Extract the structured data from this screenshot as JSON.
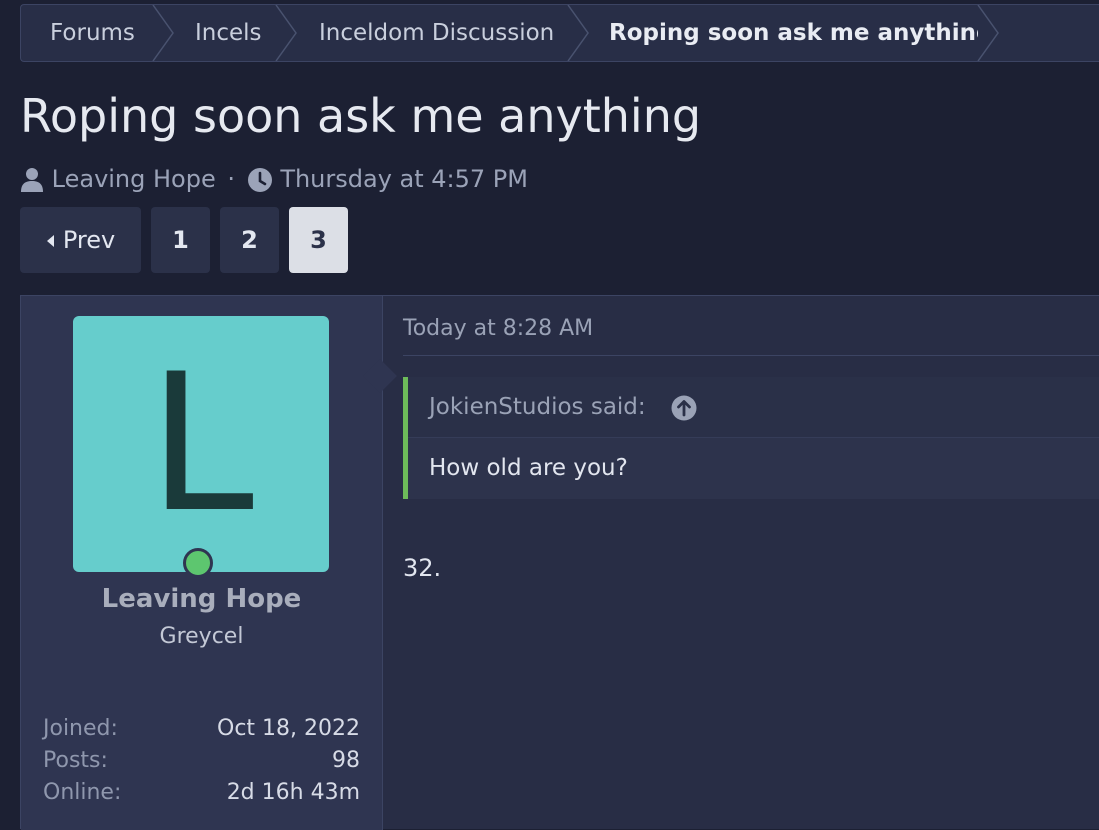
{
  "breadcrumb": {
    "items": [
      {
        "label": "Forums"
      },
      {
        "label": "Incels"
      },
      {
        "label": "Inceldom Discussion"
      },
      {
        "label": "Roping soon ask me anything"
      }
    ]
  },
  "thread": {
    "title": "Roping soon ask me anything",
    "author": "Leaving Hope",
    "separator": "·",
    "date": "Thursday at 4:57 PM"
  },
  "pagination": {
    "prev_label": "Prev",
    "pages": [
      "1",
      "2",
      "3"
    ],
    "current": "3"
  },
  "post": {
    "avatar_letter": "L",
    "avatar_color": "#66cdcc",
    "online_status_color": "#5dc66f",
    "username": "Leaving Hope",
    "user_title": "Greycel",
    "stats": [
      {
        "label": "Joined:",
        "value": "Oct 18, 2022"
      },
      {
        "label": "Posts:",
        "value": "98"
      },
      {
        "label": "Online:",
        "value": "2d 16h 43m"
      }
    ],
    "date": "Today at 8:28 AM",
    "quote": {
      "author_line": "JokienStudios said:",
      "expand_icon": "arrow-up-circle-icon",
      "text": "How old are you?",
      "accent_color": "#6dbb5a"
    },
    "body": "32."
  }
}
